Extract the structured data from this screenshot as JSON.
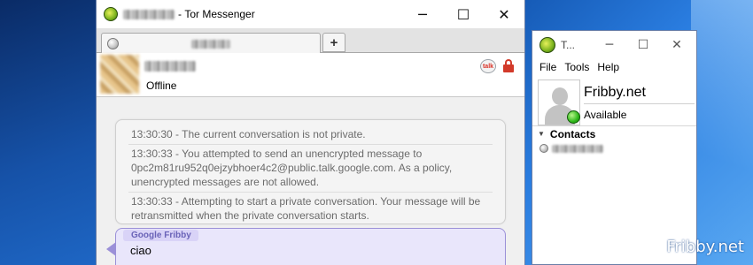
{
  "main_window": {
    "title": "Tor Messenger",
    "minimize": "─",
    "maximize": "☐",
    "close": "✕",
    "newtab": "+",
    "contact_status": "Offline",
    "talk_icon": "talk"
  },
  "system_messages": [
    "13:30:30 - The current conversation is not private.",
    "13:30:33 - You attempted to send an unencrypted message to 0pc2m81ru952q0ejzybhoer4c2@public.talk.google.com. As a policy, unencrypted messages are not allowed.",
    "13:30:33 - Attempting to start a private conversation. Your message will be retransmitted when the private conversation starts."
  ],
  "message": {
    "sender": "Google Fribby",
    "text": "ciao"
  },
  "buddy_window": {
    "title": "T...",
    "minimize": "─",
    "maximize": "☐",
    "close": "✕",
    "menu": [
      "File",
      "Tools",
      "Help"
    ],
    "profile_name": "Fribby.net",
    "profile_status": "Available",
    "contacts_header": "Contacts"
  },
  "watermark": "Fribby.net",
  "colors": {
    "sender_accent": "#6a63b8",
    "message_bg": "#e9e6fb",
    "available": "#2eb81a",
    "lock": "#d23a2a"
  }
}
